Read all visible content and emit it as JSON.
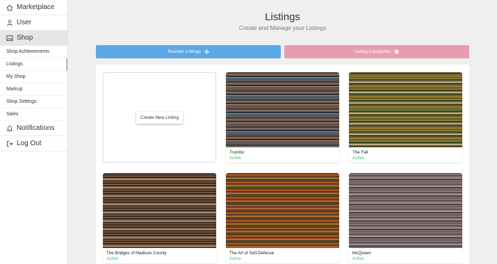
{
  "sidebar": {
    "main_items": [
      {
        "label": "Marketplace",
        "icon": "home-icon"
      },
      {
        "label": "User",
        "icon": "user-icon"
      },
      {
        "label": "Shop",
        "icon": "image-icon"
      }
    ],
    "shop_sub_items": [
      {
        "label": "Shop Achievements"
      },
      {
        "label": "Listings"
      },
      {
        "label": "My Shop"
      },
      {
        "label": "Markup"
      },
      {
        "label": "Shop Settings"
      },
      {
        "label": "Sales"
      }
    ],
    "bottom_items": [
      {
        "label": "Notifications",
        "icon": "bell-icon"
      },
      {
        "label": "Log Out",
        "icon": "logout-icon"
      }
    ]
  },
  "header": {
    "title": "Listings",
    "subtitle": "Create and Manage your Listings"
  },
  "actions": {
    "reorder_label": "Reorder Listings",
    "reorder_icon": "move-arrows-icon",
    "categories_label": "Listing Categories",
    "categories_icon": "settings-icon",
    "reorder_color": "#5aa8e6",
    "categories_color": "#e79db0"
  },
  "create_card": {
    "label": "Create New Listing"
  },
  "listings": [
    {
      "title": "Trumbo",
      "status": "Active"
    },
    {
      "title": "The Fall",
      "status": "Active"
    },
    {
      "title": "The Bridges of Madison County",
      "status": "Active"
    },
    {
      "title": "The Art of Self-Defense",
      "status": "Active"
    },
    {
      "title": "McQueen",
      "status": "Active"
    }
  ],
  "colors": {
    "active_status": "#3dbf73"
  }
}
